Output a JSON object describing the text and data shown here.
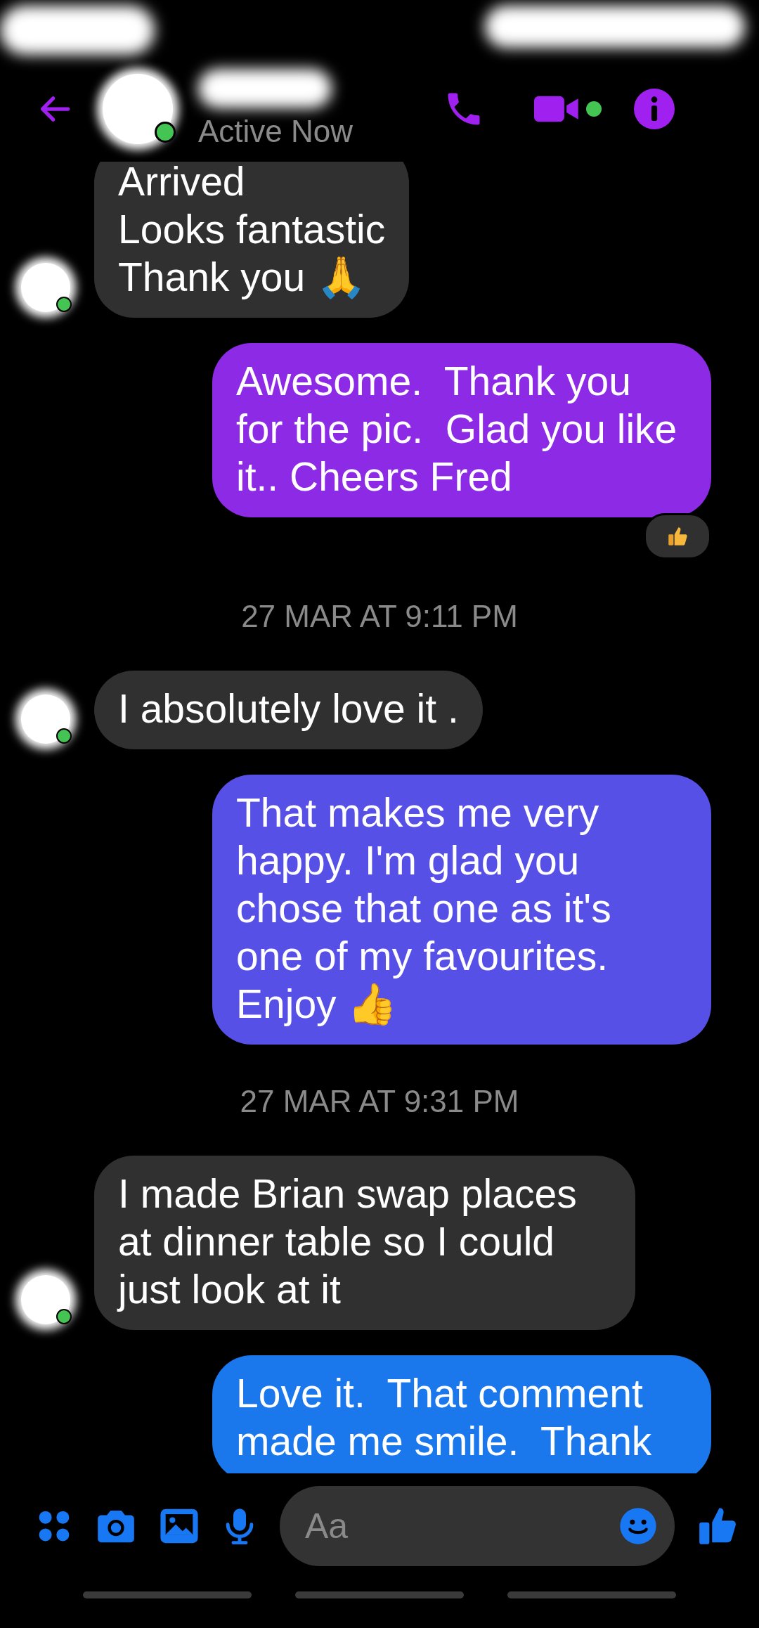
{
  "header": {
    "status": "Active Now",
    "online": true,
    "call_active": true
  },
  "messages": [
    {
      "kind": "received",
      "text": "Arrived\nLooks fantastic\nThank you 🙏",
      "online": true
    },
    {
      "kind": "sent",
      "text": "Awesome.  Thank you for the pic.  Glad you like it.. Cheers Fred",
      "reaction": true
    },
    {
      "kind": "timestamp",
      "text": "27 MAR AT 9:11 PM"
    },
    {
      "kind": "received",
      "text": "I absolutely love it .",
      "online": true
    },
    {
      "kind": "sent",
      "text": "That makes me very happy. I'm glad you chose that one as it's one of my favourites. Enjoy 👍",
      "reaction": false
    },
    {
      "kind": "timestamp",
      "text": "27 MAR AT 9:31 PM"
    },
    {
      "kind": "received",
      "text": "I made Brian swap places at dinner table so I could just look at it",
      "online": true
    },
    {
      "kind": "sent",
      "text": "Love it.  That comment made me smile.  Thank",
      "reaction": false
    }
  ],
  "composer": {
    "placeholder": "Aa"
  }
}
